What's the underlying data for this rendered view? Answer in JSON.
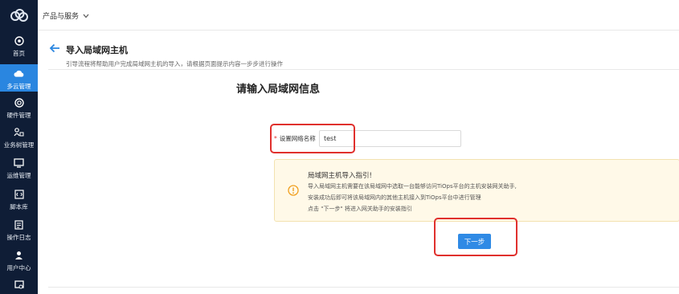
{
  "sidebar": {
    "items": [
      {
        "label": "首页",
        "icon": "home-icon"
      },
      {
        "label": "多云管理",
        "icon": "cloud-icon",
        "active": true
      },
      {
        "label": "硬件管理",
        "icon": "hardware-icon"
      },
      {
        "label": "业务树管理",
        "icon": "business-tree-icon"
      },
      {
        "label": "运维管理",
        "icon": "monitor-icon"
      },
      {
        "label": "脚本库",
        "icon": "script-icon"
      },
      {
        "label": "操作日志",
        "icon": "log-icon"
      },
      {
        "label": "用户中心",
        "icon": "user-icon"
      }
    ]
  },
  "topbar": {
    "products_label": "产品与服务"
  },
  "header": {
    "title": "导入局域网主机",
    "description": "引导流程将帮助用户完成局域网主机的导入，请根据页面提示内容一步步进行操作"
  },
  "form": {
    "title": "请输入局域网信息",
    "field_label": "设置网络名称",
    "field_required": "*",
    "field_value": "test"
  },
  "tip": {
    "title": "局域网主机导入指引!",
    "lines": [
      "导入局域网主机需要在该局域网中选取一台能够访问TiOps平台的主机安装网关助手,",
      "安装成功后即可将该局域网内的其他主机接入到TiOps平台中进行管理",
      "点击 \"下一步\" 将进入网关助手的安装指引"
    ]
  },
  "next_button": {
    "label": "下一步"
  },
  "colors": {
    "sidebar_bg": "#0f1d36",
    "accent": "#2a86e0",
    "highlight_red": "#e0302d",
    "tip_bg": "#fff9e8"
  }
}
